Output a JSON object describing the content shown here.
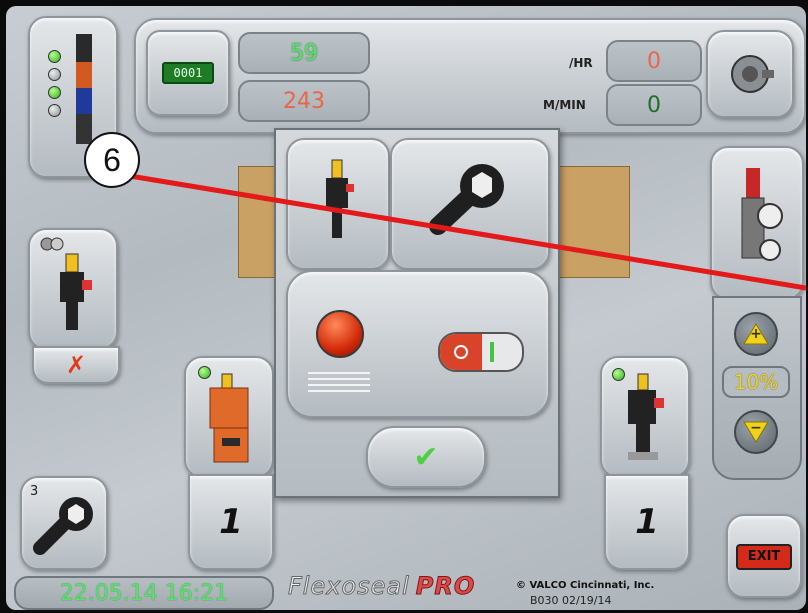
{
  "header": {
    "counter_display": "0001",
    "count_green": "59",
    "count_red": "243",
    "rate_hr_label": "/HR",
    "rate_hr_value": "0",
    "speed_label": "M/MIN",
    "speed_value": "0"
  },
  "callout": {
    "number": "6",
    "line_color": "#e41a1a"
  },
  "left": {
    "error_mark": "✗",
    "maintenance_count": "3"
  },
  "guns": [
    {
      "name": "Gun 1",
      "count": "1",
      "led": "on"
    },
    {
      "name": "Gun 2",
      "count": "1",
      "led": "on"
    }
  ],
  "right": {
    "percent": "10%",
    "up_label": "+",
    "down_label": "−",
    "exit_label": "EXIT"
  },
  "dialog": {
    "confirm_symbol": "✔"
  },
  "footer": {
    "datetime": "22.05.14 16:21",
    "brand": "Flexoseal",
    "brand_suffix": "PRO",
    "copyright": "© VALCO Cincinnati, Inc.",
    "version": "B030 02/19/14"
  },
  "colors": {
    "accent_green": "#58e06a",
    "accent_red": "#e8664a",
    "exit_red": "#d42a1a",
    "arrow_yellow": "#f0d21a"
  }
}
